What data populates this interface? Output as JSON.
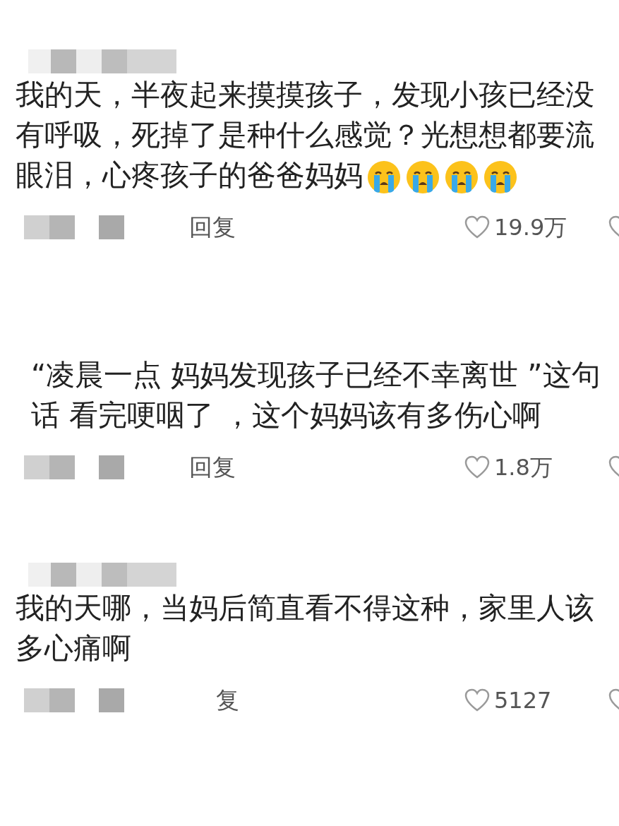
{
  "comments": [
    {
      "lines": [
        "我的天，半夜起来摸摸孩子，发现小孩已经没",
        "有呼吸，死掉了是种什么感觉？光想想都要流",
        "眼泪，心疼孩子的爸爸妈妈"
      ],
      "indented": false,
      "emojis": [
        {
          "kind": "crying"
        },
        {
          "kind": "crying"
        },
        {
          "kind": "crying"
        },
        {
          "kind": "crying"
        }
      ],
      "reply": "回复",
      "likes": "19.9万",
      "name_mosaic": true
    },
    {
      "lines": [
        "“凌晨一点 妈妈发现孩子已经不幸离世 ”这句",
        "话 看完哽咽了 ，这个妈妈该有多伤心啊"
      ],
      "indented": true,
      "reply": "回复",
      "likes": "1.8万",
      "name_mosaic": false
    },
    {
      "lines": [
        "我的天哪，当妈后简直看不得这种，家里人该",
        "多心痛啊"
      ],
      "indented": false,
      "reply": "复",
      "likes": "5127",
      "name_mosaic": true
    }
  ]
}
